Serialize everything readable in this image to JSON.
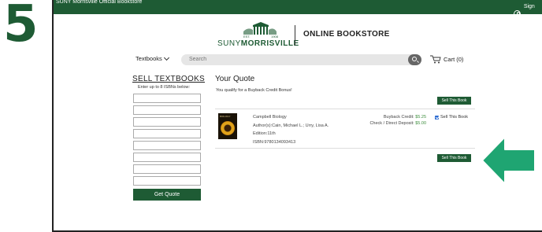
{
  "step_number": "5",
  "topbar": {
    "brand": "SUNY Morrisville Official Bookstore",
    "sign_out": "Sign Out",
    "icon": "user-icon"
  },
  "logo": {
    "est": "EST.",
    "year": "1908",
    "wordmark_light": "SUNY",
    "wordmark_bold": "MORRISVILLE"
  },
  "store_title": "ONLINE BOOKSTORE",
  "nav": {
    "textbooks": "Textbooks",
    "search_placeholder": "Search",
    "cart": "Cart (0)"
  },
  "sell": {
    "heading": "SELL TEXTBOOKS",
    "sub": "Enter up to 8 ISBNs below:",
    "isbn_fields": 8,
    "get_quote": "Get Quote"
  },
  "quote": {
    "title": "Your Quote",
    "qualify": "You qualify for a Buyback Credit Bonus!",
    "sell_button": "Sell This Book",
    "book": {
      "title": "Campbell Biology",
      "authors": "Author(s):Cain, Michael L.; Urry, Lisa A.",
      "edition": "Edition:11th",
      "isbn": "ISBN:9780134093413",
      "cover_text": "BIOLOGY"
    },
    "buyback_label": "Buyback Credit:",
    "buyback_value": "$5.25",
    "check_label": "Check / Direct Deposit:",
    "check_value": "$5.00",
    "checkbox_label": "Sell This Book",
    "checkbox_checked": true
  },
  "colors": {
    "brand_green": "#1e5b34",
    "arrow_green": "#1fa572",
    "price_green": "#3e8e3e"
  }
}
